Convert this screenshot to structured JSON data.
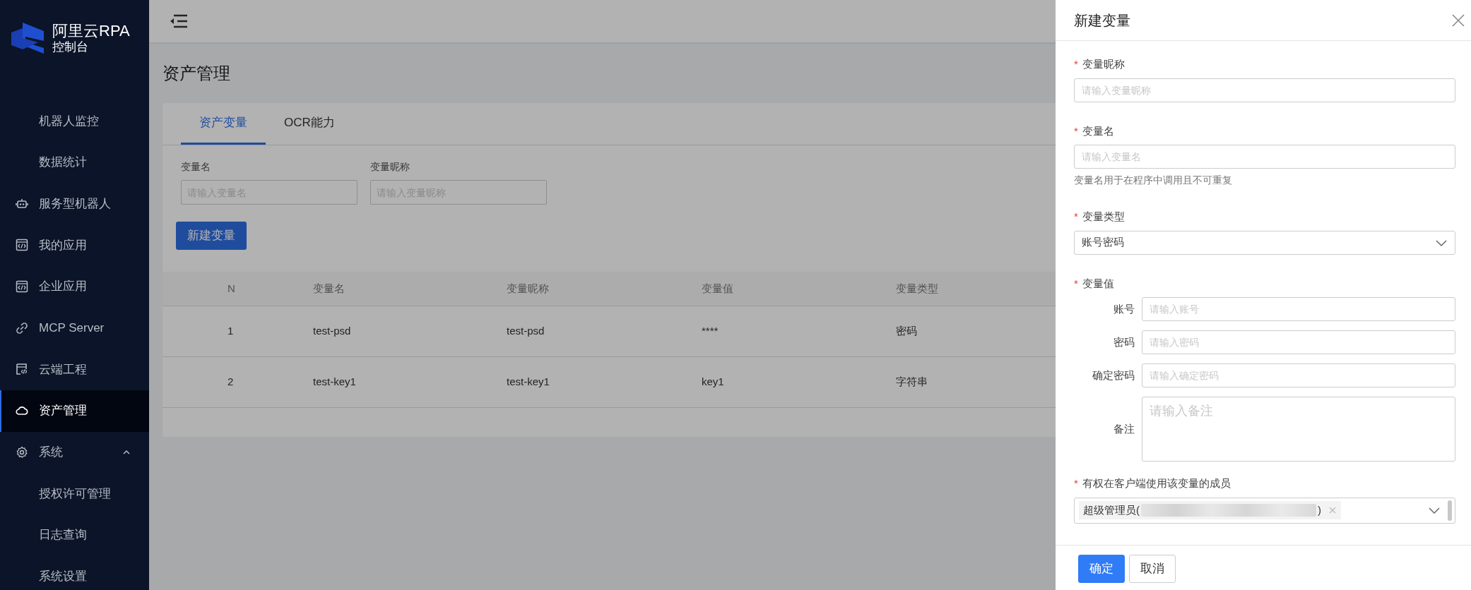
{
  "sidebar": {
    "logo": {
      "title": "阿里云RPA",
      "subtitle": "控制台"
    },
    "items": [
      {
        "children": [
          {
            "label": "机器人监控",
            "selected": false
          },
          {
            "label": "数据统计",
            "selected": false
          }
        ]
      },
      {
        "label": "服务型机器人",
        "selected": false
      },
      {
        "label": "我的应用",
        "selected": false
      },
      {
        "label": "企业应用",
        "selected": false
      },
      {
        "label": "MCP Server",
        "selected": false
      },
      {
        "label": "云端工程",
        "selected": false
      },
      {
        "label": "资产管理",
        "selected": true
      },
      {
        "label": "系统",
        "selected": false,
        "expanded": true,
        "children": [
          {
            "label": "授权许可管理",
            "selected": false
          },
          {
            "label": "日志查询",
            "selected": false
          },
          {
            "label": "系统设置",
            "selected": false
          }
        ]
      }
    ]
  },
  "page_title": "资产管理",
  "tabs": [
    {
      "label": "资产变量",
      "selected": true
    },
    {
      "label": "OCR能力",
      "selected": false
    }
  ],
  "filters": [
    {
      "label": "变量名",
      "placeholder": "请输入变量名"
    },
    {
      "label": "变量昵称",
      "placeholder": "请输入变量昵称"
    }
  ],
  "new_button": "新建变量",
  "table": {
    "columns": [
      "N",
      "变量名",
      "变量昵称",
      "变量值",
      "变量类型"
    ],
    "rows": [
      [
        "1",
        "test-psd",
        "test-psd",
        "****",
        "密码"
      ],
      [
        "2",
        "test-key1",
        "test-key1",
        "key1",
        "字符串"
      ]
    ]
  },
  "drawer": {
    "title": "新建变量",
    "fields": [
      {
        "kind": "input",
        "required_mark": "*",
        "label": "变量昵称",
        "placeholder": "请输入变量昵称"
      },
      {
        "kind": "input",
        "required_mark": "*",
        "label": "变量名",
        "placeholder": "请输入变量名",
        "help": "变量名用于在程序中调用且不可重复"
      },
      {
        "kind": "select",
        "required_mark": "*",
        "label": "变量类型",
        "value": "账号密码"
      },
      {
        "kind": "group",
        "required_mark": "*",
        "label": "变量值",
        "subfields": [
          {
            "label": "账号",
            "placeholder": "请输入账号",
            "multiline": false
          },
          {
            "label": "密码",
            "placeholder": "请输入密码",
            "multiline": false
          },
          {
            "label": "确定密码",
            "placeholder": "请输入确定密码",
            "multiline": false
          },
          {
            "label": "备注",
            "placeholder": "请输入备注",
            "multiline": true
          }
        ]
      },
      {
        "kind": "tags",
        "required_mark": "*",
        "label": "有权在客户端使用该变量的成员",
        "tags": [
          {
            "prefix": "超级管理员(",
            "suffix": ")"
          }
        ]
      }
    ],
    "buttons": [
      {
        "label": "确定",
        "primary": true
      },
      {
        "label": "取消",
        "primary": false
      }
    ]
  }
}
